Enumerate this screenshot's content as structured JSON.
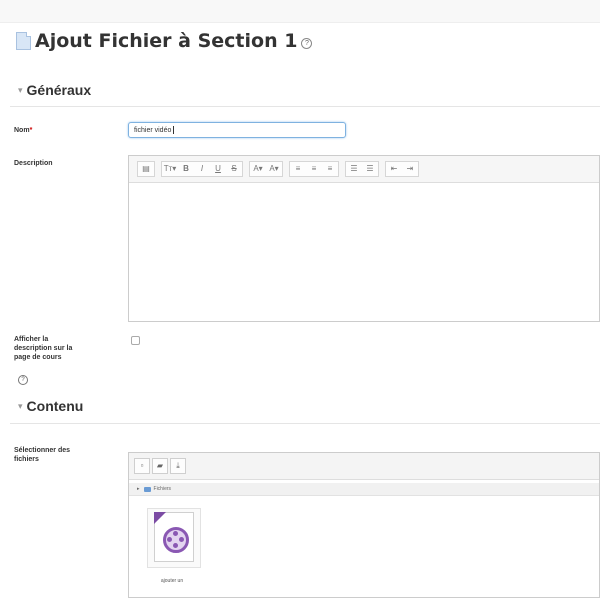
{
  "page": {
    "title": "Ajout Fichier à Section 1",
    "help_glyph": "?"
  },
  "sections": {
    "general": "Généraux",
    "content": "Contenu"
  },
  "form": {
    "name_label": "Nom",
    "name_required_mark": "*",
    "name_value": "fichier vidéo",
    "description_label": "Description",
    "show_description_label_1": "Afficher la",
    "show_description_label_2": "description sur la",
    "show_description_label_3": "page de cours",
    "show_description_checked": false,
    "select_files_label_1": "Sélectionner des",
    "select_files_label_2": "fichiers"
  },
  "editor": {
    "toolbar": [
      [
        "collapse-icon"
      ],
      [
        "font-size-icon",
        "bold-icon",
        "italic-icon",
        "underline-icon",
        "strikethrough-icon"
      ],
      [
        "text-color-icon",
        "background-color-icon"
      ],
      [
        "align-left-icon",
        "align-center-icon",
        "align-right-icon"
      ],
      [
        "unordered-list-icon",
        "ordered-list-icon"
      ],
      [
        "outdent-icon",
        "indent-icon"
      ]
    ],
    "toolbar_glyphs": [
      "▤",
      "Tт▾",
      "B",
      "I",
      "U",
      "S",
      "A▾",
      "A▾",
      "≡",
      "≡",
      "≡",
      "☰",
      "☰",
      "⇤",
      "⇥"
    ]
  },
  "filepicker": {
    "path_label": "Fichiers",
    "file_caption": "ajouter un"
  },
  "icons": {
    "title_icon": "page-icon",
    "file_icon": "video-file-icon"
  },
  "colors": {
    "title_text": "#333333",
    "required": "#cc0000",
    "input_focus": "#7fb2e0",
    "video_icon": "#8a58b3"
  }
}
